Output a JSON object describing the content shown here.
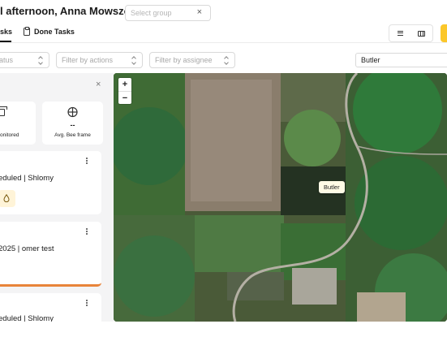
{
  "header": {
    "greeting": "l afternoon, Anna Mowszowski",
    "group_select": {
      "placeholder": "Select group",
      "clear_icon": "close-icon"
    }
  },
  "tabs": [
    {
      "label": "sks",
      "active": true
    },
    {
      "label": "Done Tasks",
      "icon": "clipboard-icon",
      "active": false
    }
  ],
  "view_toggle": {
    "options": [
      "list-icon",
      "map-icon"
    ],
    "active": "map"
  },
  "filters": {
    "status_placeholder": "atus",
    "actions_placeholder": "Filter by actions",
    "assignee_placeholder": "Filter by assignee",
    "search_value": "Butler"
  },
  "panel": {
    "close_icon": "close-icon",
    "stats": [
      {
        "icon": "box-icon",
        "value": "",
        "label": "onitored"
      },
      {
        "icon": "bee-frame-icon",
        "value": "--",
        "label": "Avg. Bee frame"
      }
    ],
    "cards": [
      {
        "title": "eduled | Shlomy",
        "badge_icon": "drop-icon",
        "menu_icon": "kebab-icon"
      },
      {
        "title": "2025 | omer test",
        "progress_color": "#e8843a",
        "menu_icon": "kebab-icon"
      },
      {
        "title": "eduled | Shlomy",
        "menu_icon": "kebab-icon"
      }
    ]
  },
  "map": {
    "zoom_in": "+",
    "zoom_out": "−",
    "location_label": "Butler"
  },
  "colors": {
    "accent": "#fbc72a",
    "progress": "#e8843a",
    "badge_bg": "#fff4d8"
  }
}
